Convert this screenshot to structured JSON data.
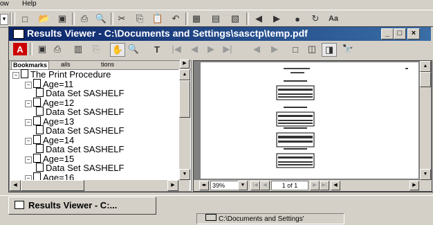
{
  "menubar": {
    "items": [
      "ow",
      "Help"
    ]
  },
  "window": {
    "title": "Results Viewer - C:\\Documents and Settings\\sasctp\\temp.pdf",
    "minimize": "_",
    "maximize": "□",
    "close": "×"
  },
  "bookmarks": {
    "tabs": [
      "Bookmarks",
      "ails",
      "tions"
    ],
    "items": [
      {
        "label": "The Print Procedure",
        "level": 0
      },
      {
        "label": "Age=11",
        "level": 1
      },
      {
        "label": "Data Set SASHELF",
        "level": 2
      },
      {
        "label": "Age=12",
        "level": 1
      },
      {
        "label": "Data Set SASHELF",
        "level": 2
      },
      {
        "label": "Age=13",
        "level": 1
      },
      {
        "label": "Data Set SASHELF",
        "level": 2
      },
      {
        "label": "Age=14",
        "level": 1
      },
      {
        "label": "Data Set SASHELF",
        "level": 2
      },
      {
        "label": "Age=15",
        "level": 1
      },
      {
        "label": "Data Set SASHELF",
        "level": 2
      },
      {
        "label": "Age=16",
        "level": 1
      }
    ]
  },
  "doc_status": {
    "zoom": "39%",
    "page": "1 of 1"
  },
  "taskbar": {
    "button_label": "Results Viewer - C:...",
    "status_path": "C:\\Documents and Settings'"
  }
}
